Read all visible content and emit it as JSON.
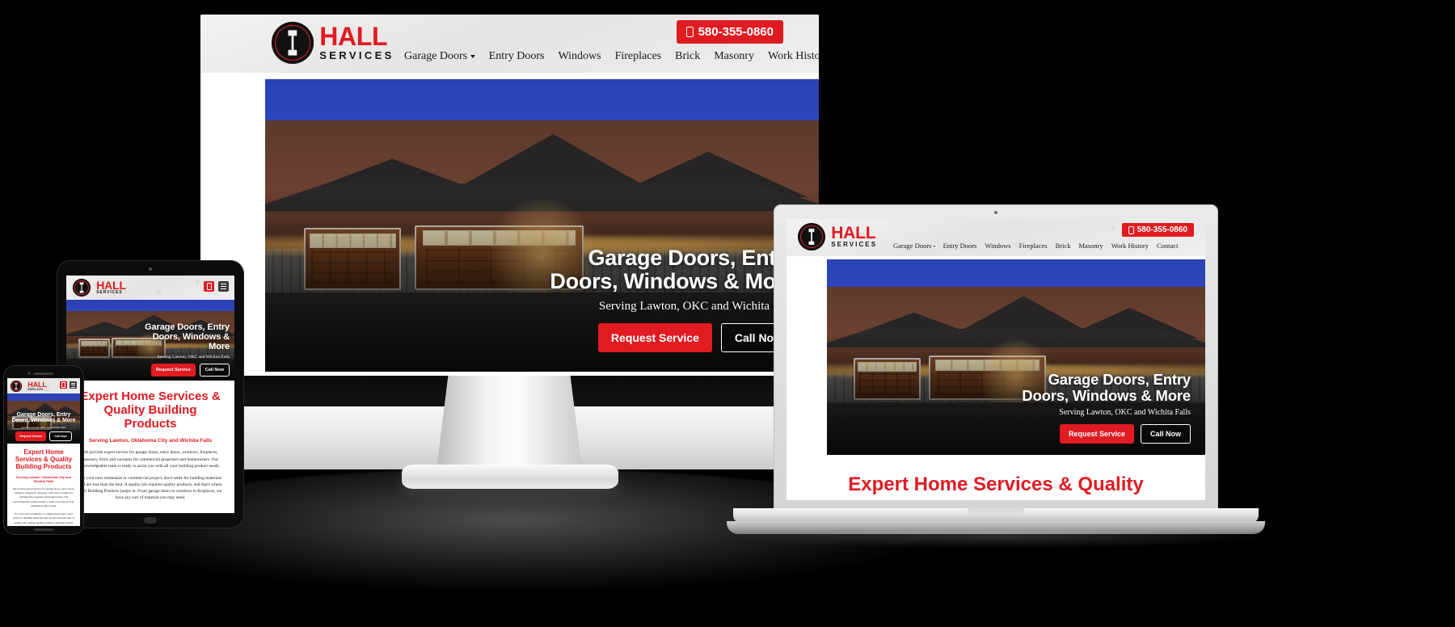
{
  "brand": {
    "name_primary": "HALL",
    "name_secondary": "SERVICES",
    "logo_letter": "H",
    "accent_red": "#e01b22",
    "dark": "#141414"
  },
  "header": {
    "phone": "580-355-0860",
    "phone_icon": "mobile-phone-icon",
    "nav": [
      {
        "label": "Garage Doors",
        "has_dropdown": true
      },
      {
        "label": "Entry Doors",
        "has_dropdown": false
      },
      {
        "label": "Windows",
        "has_dropdown": false
      },
      {
        "label": "Fireplaces",
        "has_dropdown": false
      },
      {
        "label": "Brick",
        "has_dropdown": false
      },
      {
        "label": "Masonry",
        "has_dropdown": false
      },
      {
        "label": "Work History",
        "has_dropdown": false
      },
      {
        "label": "Contact",
        "has_dropdown": false
      }
    ],
    "mobile_menu_icon": "hamburger-icon"
  },
  "hero": {
    "headline": "Garage Doors, Entry Doors, Windows & More",
    "subhead": "Serving Lawton, OKC and Wichita Falls",
    "cta_primary": "Request Service",
    "cta_secondary": "Call Now",
    "image_alt": "craftsman-home-with-two-garage-doors-at-dusk"
  },
  "section": {
    "heading": "Expert Home Services & Quality Building Products",
    "heading_partial_laptop": "Expert Home Services & Quality",
    "subheading": "Serving Lawton, Oklahoma City and Wichita Falls",
    "paragraph_1": "We provide expert service for garage doors, entry doors, windows, fireplaces, masonry, brick and vacuums for commercial properties and homeowners. Our knowledgeable team is ready to assist you with all your building product needs.",
    "paragraph_2": "For your next residential or commercial project, don't settle for building materials that are less than the best. A quality job requires quality products, and that's where Hall Building Products jumps in. From garage doors to windows to fireplaces, we have any sort of material you may need."
  },
  "devices": [
    {
      "name": "desktop-monitor"
    },
    {
      "name": "laptop"
    },
    {
      "name": "tablet"
    },
    {
      "name": "smartphone"
    }
  ]
}
